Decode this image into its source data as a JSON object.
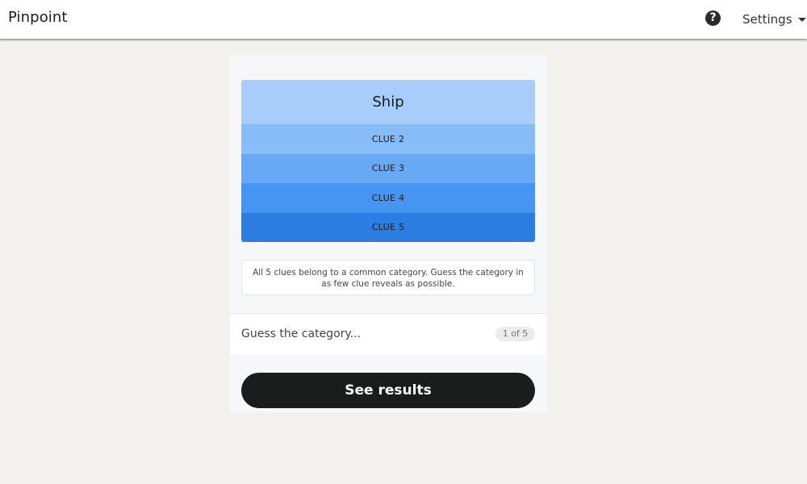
{
  "header": {
    "title": "Pinpoint",
    "help_icon": "question-circle-icon",
    "help_glyph": "?",
    "settings_label": "Settings",
    "settings_icon": "caret-down-icon"
  },
  "board": {
    "clues": [
      {
        "label": "Ship",
        "color": "#a8cdfb"
      },
      {
        "label": "CLUE 2",
        "color": "#88bcf9"
      },
      {
        "label": "CLUE 3",
        "color": "#68a9f6"
      },
      {
        "label": "CLUE 4",
        "color": "#4795f2"
      },
      {
        "label": "CLUE 5",
        "color": "#2b7de0"
      }
    ],
    "instructions": "All 5 clues belong to a common category. Guess the category in as few clue reveals as possible.",
    "guess_placeholder": "Guess the category...",
    "guess_value": "",
    "counter": "1 of 5",
    "results_label": "See results"
  },
  "colors": {
    "background": "#f2f1ee",
    "button": "#1b1c1c"
  }
}
